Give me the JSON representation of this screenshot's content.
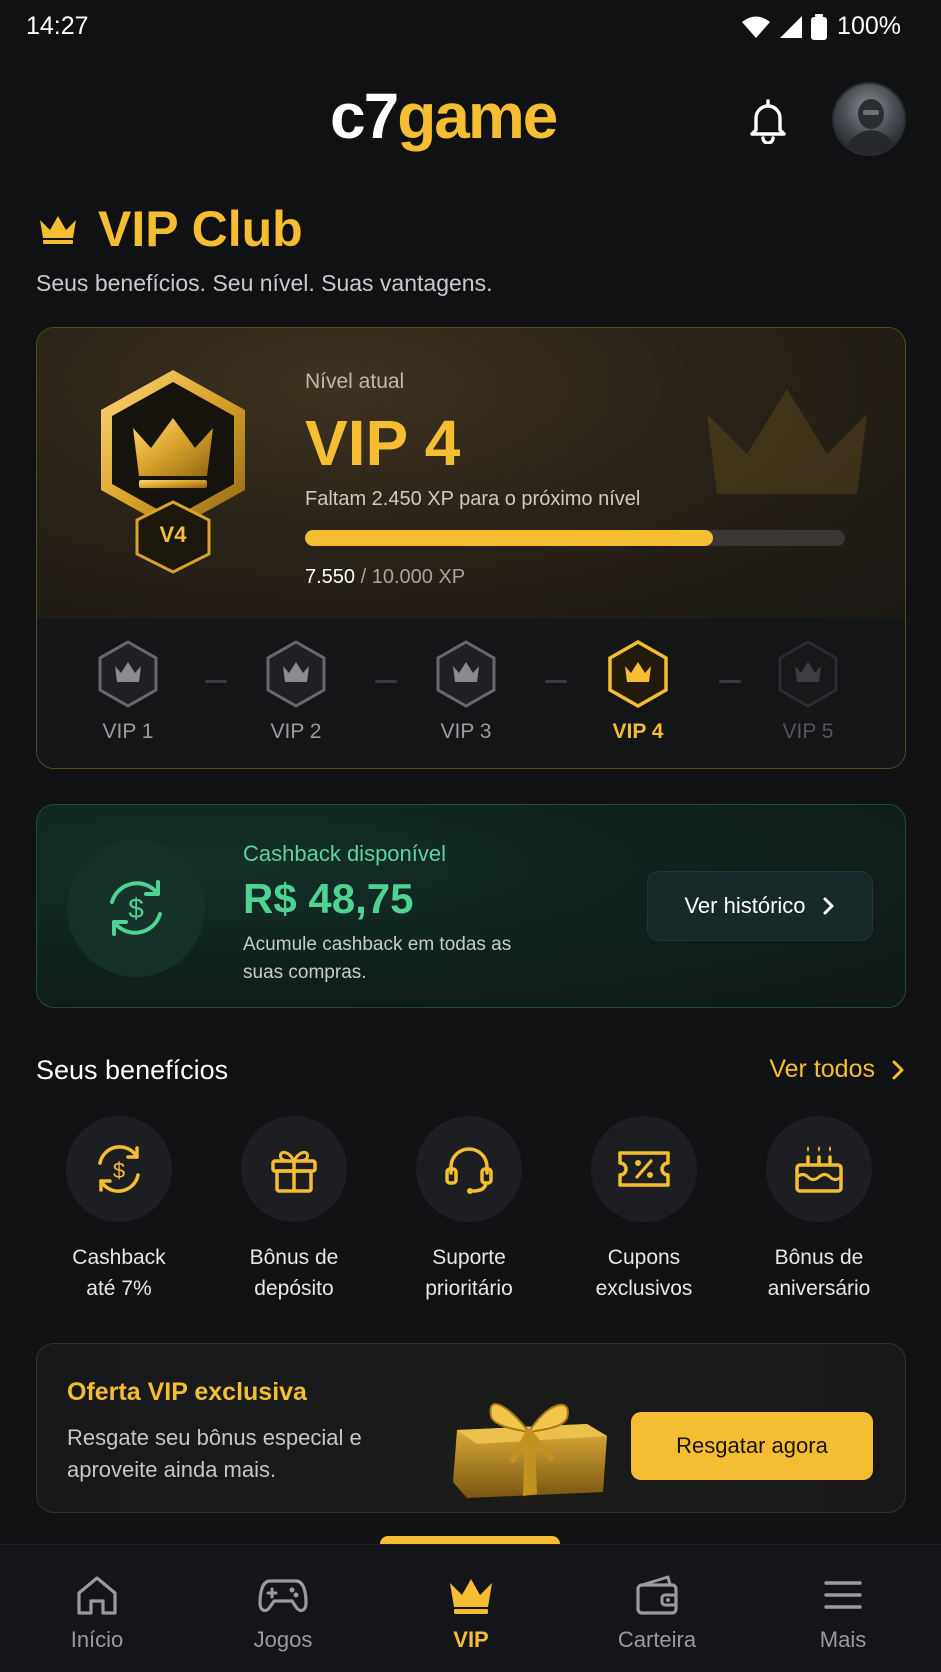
{
  "status_bar": {
    "time": "14:27",
    "battery": "100%"
  },
  "header": {
    "logo_part1": "c7",
    "logo_part2": "game"
  },
  "page": {
    "title": "VIP Club",
    "subtitle": "Seus benefícios. Seu nível. Suas vantagens."
  },
  "level_card": {
    "badge": "V4",
    "caption": "Nível atual",
    "level": "VIP 4",
    "remaining": "Faltam 2.450 XP para o próximo nível",
    "xp_current": "7.550",
    "xp_total": " / 10.000 XP",
    "progress": 0.755,
    "tiers": [
      {
        "label": "VIP 1",
        "state": "done"
      },
      {
        "label": "VIP 2",
        "state": "done"
      },
      {
        "label": "VIP 3",
        "state": "done"
      },
      {
        "label": "VIP 4",
        "state": "active"
      },
      {
        "label": "VIP 5",
        "state": "locked"
      }
    ]
  },
  "cashback": {
    "caption": "Cashback disponível",
    "amount": "R$ 48,75",
    "description": "Acumule cashback em todas as suas compras.",
    "button": "Ver histórico"
  },
  "benefits": {
    "title": "Seus benefícios",
    "link": "Ver todos",
    "items": [
      {
        "label": "Cashback\naté 7%",
        "icon": "cashback-icon"
      },
      {
        "label": "Bônus de\ndepósito",
        "icon": "gift-icon"
      },
      {
        "label": "Suporte\nprioritário",
        "icon": "headset-icon"
      },
      {
        "label": "Cupons\nexclusivos",
        "icon": "coupon-icon"
      },
      {
        "label": "Bônus de\naniversário",
        "icon": "cake-icon"
      }
    ]
  },
  "offer": {
    "title": "Oferta VIP exclusiva",
    "description": "Resgate seu bônus especial e aproveite ainda mais.",
    "button": "Resgatar agora"
  },
  "nav": {
    "items": [
      {
        "label": "Início",
        "icon": "home-icon"
      },
      {
        "label": "Jogos",
        "icon": "gamepad-icon"
      },
      {
        "label": "VIP",
        "icon": "crown-icon",
        "active": true
      },
      {
        "label": "Carteira",
        "icon": "wallet-icon"
      },
      {
        "label": "Mais",
        "icon": "menu-icon"
      }
    ]
  },
  "colors": {
    "accent": "#F5BE32",
    "cashback": "#4FD394",
    "background": "#101113"
  }
}
